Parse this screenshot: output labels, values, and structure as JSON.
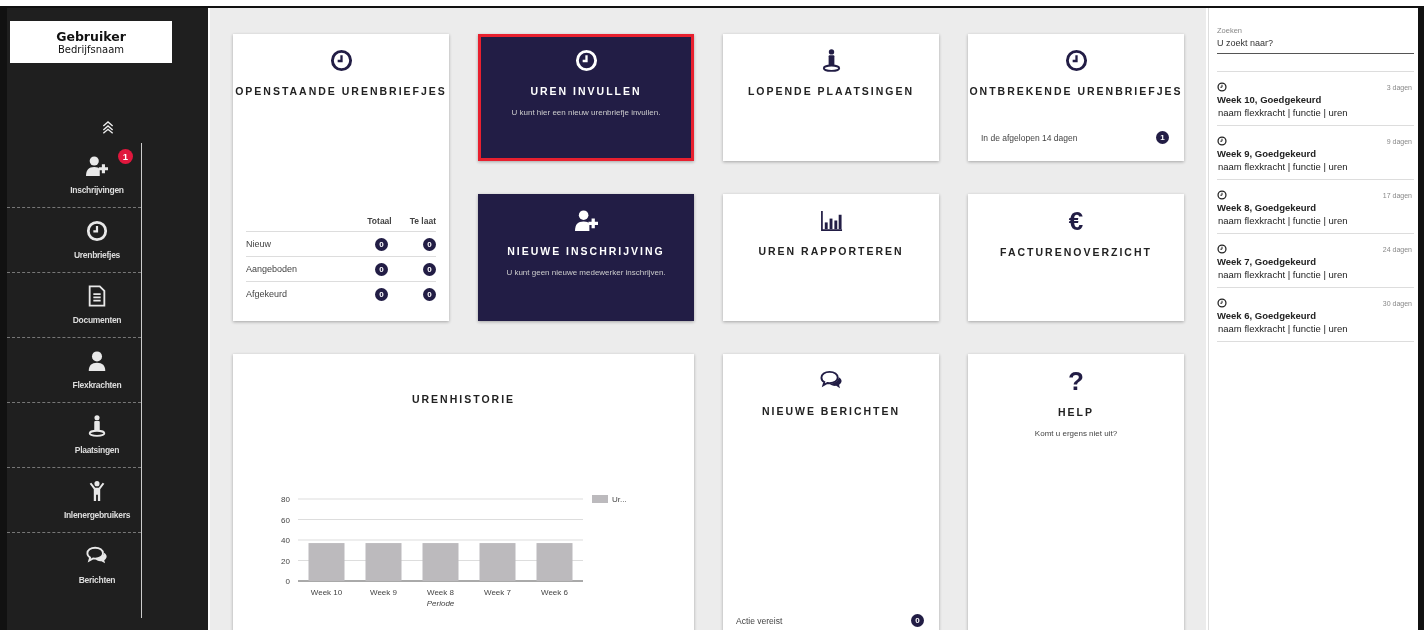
{
  "user": {
    "name": "Gebruiker",
    "company": "Bedrijfsnaam"
  },
  "sidebar": {
    "items": [
      {
        "label": "Inschrijvingen",
        "badge": "1"
      },
      {
        "label": "Urenbriefjes"
      },
      {
        "label": "Documenten"
      },
      {
        "label": "Flexkrachten"
      },
      {
        "label": "Plaatsingen"
      },
      {
        "label": "Inlenergebruikers"
      },
      {
        "label": "Berichten"
      }
    ]
  },
  "tiles": [
    {
      "kind": "table",
      "selected": false,
      "title": "OPENSTAANDE URENBRIEFJES",
      "columns": [
        "Totaal",
        "Te laat"
      ],
      "rows": [
        {
          "label": "Nieuw",
          "values": [
            "0",
            "0"
          ]
        },
        {
          "label": "Aangeboden",
          "values": [
            "0",
            "0"
          ]
        },
        {
          "label": "Afgekeurd",
          "values": [
            "0",
            "0"
          ]
        }
      ]
    },
    {
      "kind": "action",
      "selected": true,
      "title": "UREN INVULLEN",
      "subtitle": "U kunt hier een nieuw urenbriefje invullen."
    },
    {
      "kind": "tile",
      "selected": false,
      "title": "LOPENDE PLAATSINGEN"
    },
    {
      "kind": "tile",
      "selected": false,
      "title": "ONTBREKENDE URENBRIEFJES",
      "count_label": "In de afgelopen 14 dagen",
      "count": "1"
    },
    {
      "kind": "action",
      "selected": false,
      "title": "NIEUWE INSCHRIJVING",
      "subtitle": "U kunt geen nieuwe medewerker inschrijven."
    },
    {
      "kind": "tile",
      "selected": false,
      "title": "UREN RAPPORTEREN"
    },
    {
      "kind": "tile",
      "selected": false,
      "glyph": "€",
      "title": "FACTURENOVERZICHT"
    },
    {
      "kind": "chart",
      "selected": false,
      "title": "URENHISTORIE",
      "chart_data": {
        "type": "bar",
        "xlabel": "Periode",
        "categories": [
          "Week 10",
          "Week 9",
          "Week 8",
          "Week 7",
          "Week 6"
        ],
        "series": [
          {
            "name": "Ur...",
            "color": "#bcbabd",
            "values": [
              37,
              37,
              37,
              37,
              37
            ]
          }
        ],
        "ylim": [
          0,
          80
        ],
        "yticks": [
          0,
          20,
          40,
          60,
          80
        ],
        "grid": true
      }
    },
    {
      "kind": "tile",
      "selected": false,
      "title": "NIEUWE BERICHTEN",
      "count_label": "Actie vereist",
      "count": "0"
    },
    {
      "kind": "tile",
      "selected": false,
      "glyph": "?",
      "title": "HELP",
      "subtitle": "Komt u ergens niet uit?"
    }
  ],
  "search": {
    "label": "Zoeken",
    "placeholder": "U zoekt naar?"
  },
  "feed": [
    {
      "age": "3 dagen",
      "title": "Week 10, Goedgekeurd",
      "detail": "naam flexkracht | functie | uren"
    },
    {
      "age": "9 dagen",
      "title": "Week 9, Goedgekeurd",
      "detail": "naam flexkracht | functie | uren"
    },
    {
      "age": "17 dagen",
      "title": "Week 8, Goedgekeurd",
      "detail": "naam flexkracht | functie | uren"
    },
    {
      "age": "24 dagen",
      "title": "Week 7, Goedgekeurd",
      "detail": "naam flexkracht | functie | uren"
    },
    {
      "age": "30 dagen",
      "title": "Week 6, Goedgekeurd",
      "detail": "naam flexkracht | functie | uren"
    }
  ]
}
